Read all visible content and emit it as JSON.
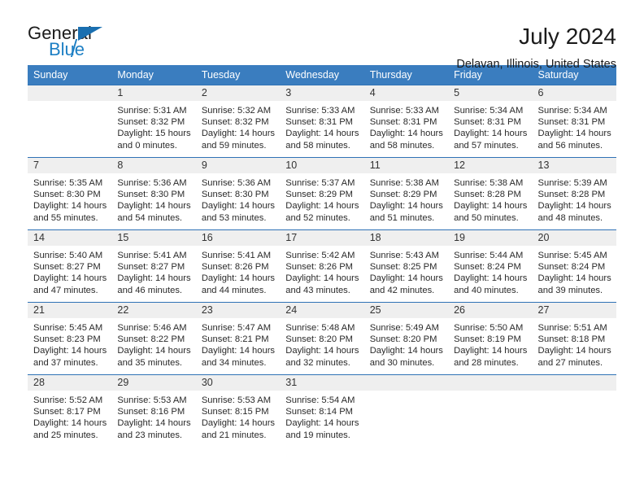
{
  "brand": {
    "name_part1": "General",
    "name_part2": "Blue",
    "logo_icon": "triangle-flag-icon",
    "accent_color": "#1d7fc4"
  },
  "header": {
    "title": "July 2024",
    "location": "Delavan, Illinois, United States",
    "header_bg_color": "#3a7dbf",
    "daynum_bg_color": "#efefef"
  },
  "weekdays": [
    "Sunday",
    "Monday",
    "Tuesday",
    "Wednesday",
    "Thursday",
    "Friday",
    "Saturday"
  ],
  "labels": {
    "sunrise": "Sunrise:",
    "sunset": "Sunset:",
    "daylight": "Daylight:"
  },
  "weeks": [
    [
      {
        "day": "",
        "sunrise": "",
        "sunset": "",
        "daylight1": "",
        "daylight2": ""
      },
      {
        "day": "1",
        "sunrise": "Sunrise: 5:31 AM",
        "sunset": "Sunset: 8:32 PM",
        "daylight1": "Daylight: 15 hours",
        "daylight2": "and 0 minutes."
      },
      {
        "day": "2",
        "sunrise": "Sunrise: 5:32 AM",
        "sunset": "Sunset: 8:32 PM",
        "daylight1": "Daylight: 14 hours",
        "daylight2": "and 59 minutes."
      },
      {
        "day": "3",
        "sunrise": "Sunrise: 5:33 AM",
        "sunset": "Sunset: 8:31 PM",
        "daylight1": "Daylight: 14 hours",
        "daylight2": "and 58 minutes."
      },
      {
        "day": "4",
        "sunrise": "Sunrise: 5:33 AM",
        "sunset": "Sunset: 8:31 PM",
        "daylight1": "Daylight: 14 hours",
        "daylight2": "and 58 minutes."
      },
      {
        "day": "5",
        "sunrise": "Sunrise: 5:34 AM",
        "sunset": "Sunset: 8:31 PM",
        "daylight1": "Daylight: 14 hours",
        "daylight2": "and 57 minutes."
      },
      {
        "day": "6",
        "sunrise": "Sunrise: 5:34 AM",
        "sunset": "Sunset: 8:31 PM",
        "daylight1": "Daylight: 14 hours",
        "daylight2": "and 56 minutes."
      }
    ],
    [
      {
        "day": "7",
        "sunrise": "Sunrise: 5:35 AM",
        "sunset": "Sunset: 8:30 PM",
        "daylight1": "Daylight: 14 hours",
        "daylight2": "and 55 minutes."
      },
      {
        "day": "8",
        "sunrise": "Sunrise: 5:36 AM",
        "sunset": "Sunset: 8:30 PM",
        "daylight1": "Daylight: 14 hours",
        "daylight2": "and 54 minutes."
      },
      {
        "day": "9",
        "sunrise": "Sunrise: 5:36 AM",
        "sunset": "Sunset: 8:30 PM",
        "daylight1": "Daylight: 14 hours",
        "daylight2": "and 53 minutes."
      },
      {
        "day": "10",
        "sunrise": "Sunrise: 5:37 AM",
        "sunset": "Sunset: 8:29 PM",
        "daylight1": "Daylight: 14 hours",
        "daylight2": "and 52 minutes."
      },
      {
        "day": "11",
        "sunrise": "Sunrise: 5:38 AM",
        "sunset": "Sunset: 8:29 PM",
        "daylight1": "Daylight: 14 hours",
        "daylight2": "and 51 minutes."
      },
      {
        "day": "12",
        "sunrise": "Sunrise: 5:38 AM",
        "sunset": "Sunset: 8:28 PM",
        "daylight1": "Daylight: 14 hours",
        "daylight2": "and 50 minutes."
      },
      {
        "day": "13",
        "sunrise": "Sunrise: 5:39 AM",
        "sunset": "Sunset: 8:28 PM",
        "daylight1": "Daylight: 14 hours",
        "daylight2": "and 48 minutes."
      }
    ],
    [
      {
        "day": "14",
        "sunrise": "Sunrise: 5:40 AM",
        "sunset": "Sunset: 8:27 PM",
        "daylight1": "Daylight: 14 hours",
        "daylight2": "and 47 minutes."
      },
      {
        "day": "15",
        "sunrise": "Sunrise: 5:41 AM",
        "sunset": "Sunset: 8:27 PM",
        "daylight1": "Daylight: 14 hours",
        "daylight2": "and 46 minutes."
      },
      {
        "day": "16",
        "sunrise": "Sunrise: 5:41 AM",
        "sunset": "Sunset: 8:26 PM",
        "daylight1": "Daylight: 14 hours",
        "daylight2": "and 44 minutes."
      },
      {
        "day": "17",
        "sunrise": "Sunrise: 5:42 AM",
        "sunset": "Sunset: 8:26 PM",
        "daylight1": "Daylight: 14 hours",
        "daylight2": "and 43 minutes."
      },
      {
        "day": "18",
        "sunrise": "Sunrise: 5:43 AM",
        "sunset": "Sunset: 8:25 PM",
        "daylight1": "Daylight: 14 hours",
        "daylight2": "and 42 minutes."
      },
      {
        "day": "19",
        "sunrise": "Sunrise: 5:44 AM",
        "sunset": "Sunset: 8:24 PM",
        "daylight1": "Daylight: 14 hours",
        "daylight2": "and 40 minutes."
      },
      {
        "day": "20",
        "sunrise": "Sunrise: 5:45 AM",
        "sunset": "Sunset: 8:24 PM",
        "daylight1": "Daylight: 14 hours",
        "daylight2": "and 39 minutes."
      }
    ],
    [
      {
        "day": "21",
        "sunrise": "Sunrise: 5:45 AM",
        "sunset": "Sunset: 8:23 PM",
        "daylight1": "Daylight: 14 hours",
        "daylight2": "and 37 minutes."
      },
      {
        "day": "22",
        "sunrise": "Sunrise: 5:46 AM",
        "sunset": "Sunset: 8:22 PM",
        "daylight1": "Daylight: 14 hours",
        "daylight2": "and 35 minutes."
      },
      {
        "day": "23",
        "sunrise": "Sunrise: 5:47 AM",
        "sunset": "Sunset: 8:21 PM",
        "daylight1": "Daylight: 14 hours",
        "daylight2": "and 34 minutes."
      },
      {
        "day": "24",
        "sunrise": "Sunrise: 5:48 AM",
        "sunset": "Sunset: 8:20 PM",
        "daylight1": "Daylight: 14 hours",
        "daylight2": "and 32 minutes."
      },
      {
        "day": "25",
        "sunrise": "Sunrise: 5:49 AM",
        "sunset": "Sunset: 8:20 PM",
        "daylight1": "Daylight: 14 hours",
        "daylight2": "and 30 minutes."
      },
      {
        "day": "26",
        "sunrise": "Sunrise: 5:50 AM",
        "sunset": "Sunset: 8:19 PM",
        "daylight1": "Daylight: 14 hours",
        "daylight2": "and 28 minutes."
      },
      {
        "day": "27",
        "sunrise": "Sunrise: 5:51 AM",
        "sunset": "Sunset: 8:18 PM",
        "daylight1": "Daylight: 14 hours",
        "daylight2": "and 27 minutes."
      }
    ],
    [
      {
        "day": "28",
        "sunrise": "Sunrise: 5:52 AM",
        "sunset": "Sunset: 8:17 PM",
        "daylight1": "Daylight: 14 hours",
        "daylight2": "and 25 minutes."
      },
      {
        "day": "29",
        "sunrise": "Sunrise: 5:53 AM",
        "sunset": "Sunset: 8:16 PM",
        "daylight1": "Daylight: 14 hours",
        "daylight2": "and 23 minutes."
      },
      {
        "day": "30",
        "sunrise": "Sunrise: 5:53 AM",
        "sunset": "Sunset: 8:15 PM",
        "daylight1": "Daylight: 14 hours",
        "daylight2": "and 21 minutes."
      },
      {
        "day": "31",
        "sunrise": "Sunrise: 5:54 AM",
        "sunset": "Sunset: 8:14 PM",
        "daylight1": "Daylight: 14 hours",
        "daylight2": "and 19 minutes."
      },
      {
        "day": "",
        "sunrise": "",
        "sunset": "",
        "daylight1": "",
        "daylight2": ""
      },
      {
        "day": "",
        "sunrise": "",
        "sunset": "",
        "daylight1": "",
        "daylight2": ""
      },
      {
        "day": "",
        "sunrise": "",
        "sunset": "",
        "daylight1": "",
        "daylight2": ""
      }
    ]
  ]
}
